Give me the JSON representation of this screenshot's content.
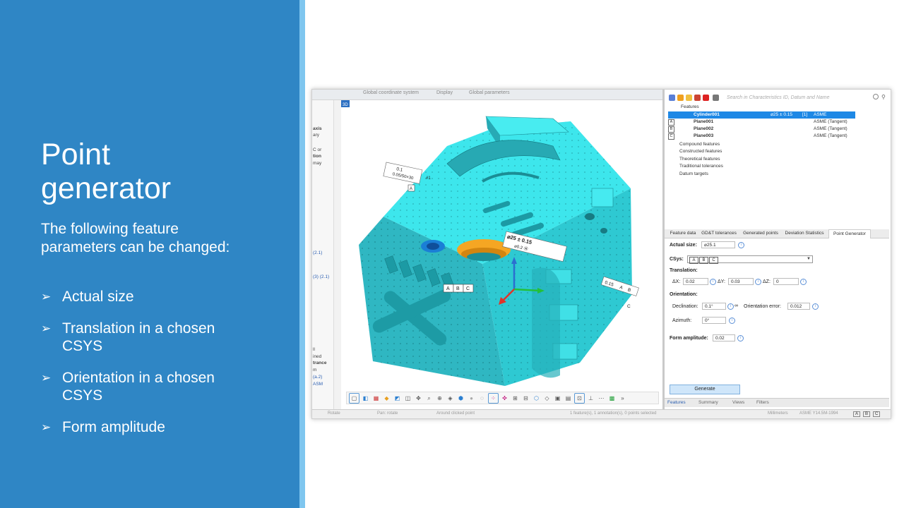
{
  "slide": {
    "title_line1": "Point",
    "title_line2": "generator",
    "intro": "The following feature parameters can be changed:",
    "bullets": [
      {
        "line1": "Actual size",
        "line2": ""
      },
      {
        "line1": "Translation in a chosen",
        "line2": "CSYS"
      },
      {
        "line1": "Orientation in a chosen",
        "line2": "CSYS"
      },
      {
        "line1": "Form amplitude",
        "line2": ""
      }
    ],
    "colors": {
      "panel": "#2f86c5",
      "accent": "#7fc6ef",
      "model": "#3ee0e6",
      "hole_highlight": "#f5a623"
    }
  },
  "app": {
    "top_tabs": [
      "Global coordinate system",
      "Display",
      "Global parameters"
    ],
    "left_strip": [
      "axis",
      "ary",
      "C or",
      "tion",
      "may",
      "(2.1)",
      "(3) (2.1)",
      "ll",
      "ined",
      "trance",
      "m",
      "(a.2)",
      "ASM"
    ],
    "viewport": {
      "badge": "3D",
      "annotations": {
        "flatness_val": "0.1",
        "flatness_sub": "0.05/50×30",
        "flatness_ref": "#1",
        "flatness_datum": "A",
        "diam": "⌀25 ± 0.15",
        "pos_tol": "⌀0.2 Ⓜ",
        "datums": [
          "A",
          "B",
          "C"
        ],
        "right_tol": "0.15",
        "right_datums": [
          "A",
          "B"
        ],
        "right_c": "C"
      },
      "toolbar_icons": [
        "select-icon",
        "box-icon",
        "grid-icon",
        "orange-icon",
        "blue-icon",
        "frame-icon",
        "zoom-in-icon",
        "zoom-out-icon",
        "render-icon",
        "cube-icon",
        "sphere-icon",
        "point-icon",
        "pink-icon",
        "fit-icon",
        "pan-icon",
        "axis-icon",
        "layer-icon",
        "shade-icon",
        "view-icon",
        "camera-icon",
        "wire-icon",
        "edges-icon",
        "triad-icon",
        "color-icon",
        "mode-icon",
        "more-icon"
      ]
    },
    "right_panel": {
      "search_placeholder": "Search in Characteristics ID, Datum and Name",
      "tree": {
        "root": "Features",
        "rows": [
          {
            "datum": "",
            "name": "Cylinder001",
            "value": "⌀25 ± 0.15",
            "tol_ref": "[1]",
            "standard": "ASME",
            "selected": true
          },
          {
            "datum": "A",
            "name": "Plane001",
            "value": "",
            "tol_ref": "",
            "standard": "ASME (Tangent)",
            "selected": false
          },
          {
            "datum": "B",
            "name": "Plane002",
            "value": "",
            "tol_ref": "",
            "standard": "ASME (Tangent)",
            "selected": false
          },
          {
            "datum": "C",
            "name": "Plane003",
            "value": "",
            "tol_ref": "",
            "standard": "ASME (Tangent)",
            "selected": false
          }
        ],
        "groups": [
          "Compound features",
          "Constructed features",
          "Theoretical features",
          "Traditional tolerances",
          "Datum targets"
        ]
      },
      "tabs": [
        "Feature data",
        "GD&T tolerances",
        "Generated points",
        "Deviation Statistics",
        "Point Generator"
      ],
      "active_tab": "Point Generator",
      "form": {
        "actual_size_label": "Actual size:",
        "actual_size": "⌀25.1",
        "csys_label": "CSys:",
        "csys_datums": [
          "A",
          "B",
          "C"
        ],
        "translation_label": "Translation:",
        "dx_label": "ΔX:",
        "dx": "0.02",
        "dy_label": "ΔY:",
        "dy": "0.03",
        "dz_label": "ΔZ:",
        "dz": "0",
        "orientation_label": "Orientation:",
        "declination_label": "Declination:",
        "declination": "0.1°",
        "orientation_error_label": "Orientation error:",
        "orientation_error": "0.012",
        "azimuth_label": "Azimuth:",
        "azimuth": "0°",
        "form_amplitude_label": "Form amplitude:",
        "form_amplitude": "0.02",
        "generate_label": "Generate"
      },
      "bottom_tabs": [
        "Features",
        "Summary",
        "Views",
        "Filters"
      ]
    },
    "status": {
      "left": [
        "Rotate",
        "Pan: rotate",
        "Around clicked point"
      ],
      "mid": "1 feature(s), 1 annotation(s), 0 points selected",
      "units": "Millimeters",
      "standard": "ASME Y14.5M-1994",
      "datums": [
        "A",
        "B",
        "C"
      ]
    }
  }
}
